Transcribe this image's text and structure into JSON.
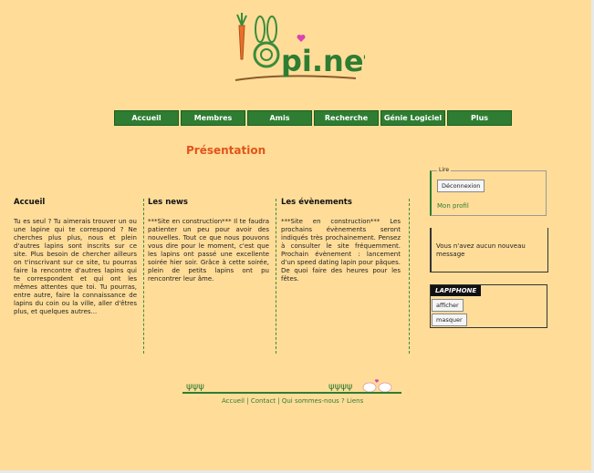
{
  "logo": {
    "text": "pi.net"
  },
  "nav": {
    "items": [
      {
        "label": "Accueil"
      },
      {
        "label": "Membres"
      },
      {
        "label": "Amis"
      },
      {
        "label": "Recherche"
      },
      {
        "label": "Génie Logiciel"
      },
      {
        "label": "Plus"
      }
    ]
  },
  "page": {
    "title": "Présentation"
  },
  "columns": [
    {
      "heading": "Accueil",
      "body": "Tu es seul ? Tu aimerais trouver un ou une lapine qui te correspond ? Ne cherches plus plus, nous et plein d'autres lapins sont inscrits sur ce site. Plus besoin de chercher ailleurs on t'inscrivant sur ce site, tu pourras faire la rencontre d'autres lapins qui te correspondent et qui ont les mêmes attentes que toi. Tu pourras, entre autre, faire la connaissance de lapins du coin ou la ville, aller d'êtres plus, et quelques autres..."
    },
    {
      "heading": "Les news",
      "body": "***Site en construction*** Il te faudra patienter un peu pour avoir des nouvelles. Tout ce que nous pouvons vous dire pour le moment, c'est que les lapins ont passé une excellente soirée hier soir. Grâce à cette soirée, plein de petits lapins ont pu rencontrer leur âme."
    },
    {
      "heading": "Les évènements",
      "body": "***Site en construction*** Les prochains évènements seront indiqués très prochainement. Pensez à consulter le site fréquemment. Prochain évènement : lancement d'un speed dating lapin pour pâques. De quoi faire des heures pour les fêtes."
    }
  ],
  "sidebar": {
    "login": {
      "legend": "Lire",
      "button": "Déconnexion",
      "link": "Mon profil"
    },
    "messages": {
      "text": "Vous n'avez aucun nouveau message"
    },
    "lapiphone": {
      "title": "LAPIPHONE",
      "show_button": "afficher",
      "hide_button": "masquer"
    }
  },
  "footer": {
    "link1": "Accueil",
    "sep1": " | ",
    "link2": "Contact",
    "sep2": " | ",
    "link3": "Qui sommes-nous ?",
    "link4": "Liens"
  },
  "colors": {
    "background": "#ffdd99",
    "accent_green": "#2e7d32",
    "title_orange": "#e2541a"
  }
}
